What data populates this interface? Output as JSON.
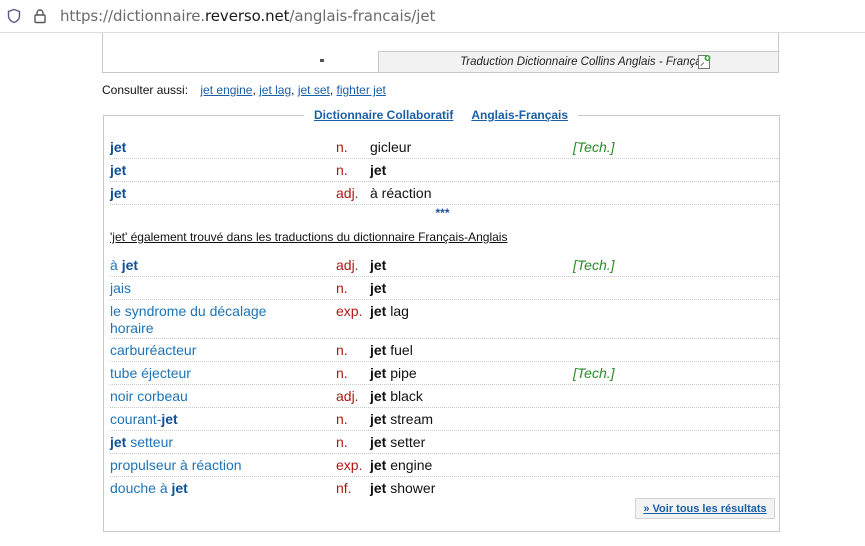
{
  "browser": {
    "url_prefix": "https://dictionnaire.",
    "url_host": "reverso.net",
    "url_path": "/anglais-francais/jet"
  },
  "collins": {
    "footer": "Traduction Dictionnaire Collins Anglais - Français"
  },
  "consult": {
    "label": "Consulter aussi:",
    "links": [
      "jet engine",
      "jet lag",
      "jet set",
      "fighter jet"
    ]
  },
  "collab": {
    "title_left": "Dictionnaire Collaboratif",
    "title_right": "Anglais-Français",
    "entries": [
      {
        "term": "jet",
        "pos": "n.",
        "translation": "gicleur",
        "domain": "[Tech.]"
      },
      {
        "term": "jet",
        "pos": "n.",
        "translation": "jet",
        "domain": ""
      },
      {
        "term": "jet",
        "pos": "adj.",
        "translation": "à réaction",
        "domain": ""
      }
    ],
    "separator": "***",
    "also_found": "'jet' également trouvé dans les traductions du dictionnaire Français-Anglais",
    "reverse_entries": [
      {
        "term_pre": "à ",
        "term_bold": "jet",
        "term_post": "",
        "pos": "adj.",
        "tr_bold": "jet",
        "tr_rest": "",
        "domain": "[Tech.]"
      },
      {
        "term_pre": "jais",
        "term_bold": "",
        "term_post": "",
        "pos": "n.",
        "tr_bold": "jet",
        "tr_rest": "",
        "domain": ""
      },
      {
        "term_pre": "le syndrome du décalage horaire",
        "term_bold": "",
        "term_post": "",
        "pos": "exp.",
        "tr_bold": "jet",
        "tr_rest": " lag",
        "domain": ""
      },
      {
        "term_pre": "carburéacteur",
        "term_bold": "",
        "term_post": "",
        "pos": "n.",
        "tr_bold": "jet",
        "tr_rest": " fuel",
        "domain": ""
      },
      {
        "term_pre": "tube éjecteur",
        "term_bold": "",
        "term_post": "",
        "pos": "n.",
        "tr_bold": "jet",
        "tr_rest": " pipe",
        "domain": "[Tech.]"
      },
      {
        "term_pre": "noir corbeau",
        "term_bold": "",
        "term_post": "",
        "pos": "adj.",
        "tr_bold": "jet",
        "tr_rest": " black",
        "domain": ""
      },
      {
        "term_pre": "courant-",
        "term_bold": "jet",
        "term_post": "",
        "pos": "n.",
        "tr_bold": "jet",
        "tr_rest": " stream",
        "domain": ""
      },
      {
        "term_pre": "",
        "term_bold": "jet",
        "term_post": " setteur",
        "pos": "n.",
        "tr_bold": "jet",
        "tr_rest": " setter",
        "domain": ""
      },
      {
        "term_pre": "propulseur à réaction",
        "term_bold": "",
        "term_post": "",
        "pos": "exp.",
        "tr_bold": "jet",
        "tr_rest": " engine",
        "domain": ""
      },
      {
        "term_pre": "douche à ",
        "term_bold": "jet",
        "term_post": "",
        "pos": "nf.",
        "tr_bold": "jet",
        "tr_rest": " shower",
        "domain": ""
      }
    ],
    "more_results": "» Voir tous les résultats"
  },
  "colors": {
    "link": "#1a5fa8",
    "pos": "#b01818",
    "domain": "#2a8a2a"
  }
}
